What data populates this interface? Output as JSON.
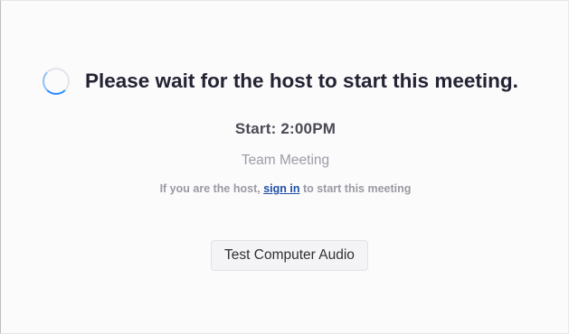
{
  "waiting": {
    "headline": "Please wait for the host to start this meeting.",
    "start_time": "Start: 2:00PM",
    "topic": "Team Meeting",
    "host_prefix": "If you are the host, ",
    "sign_in_link": "sign in",
    "host_suffix": " to start this meeting"
  },
  "actions": {
    "test_audio_label": "Test Computer Audio"
  },
  "icons": {
    "loading": "loading-spinner-icon"
  },
  "colors": {
    "link": "#1f4fa6",
    "spinner_accent": "#2d8cff",
    "headline": "#232333"
  }
}
